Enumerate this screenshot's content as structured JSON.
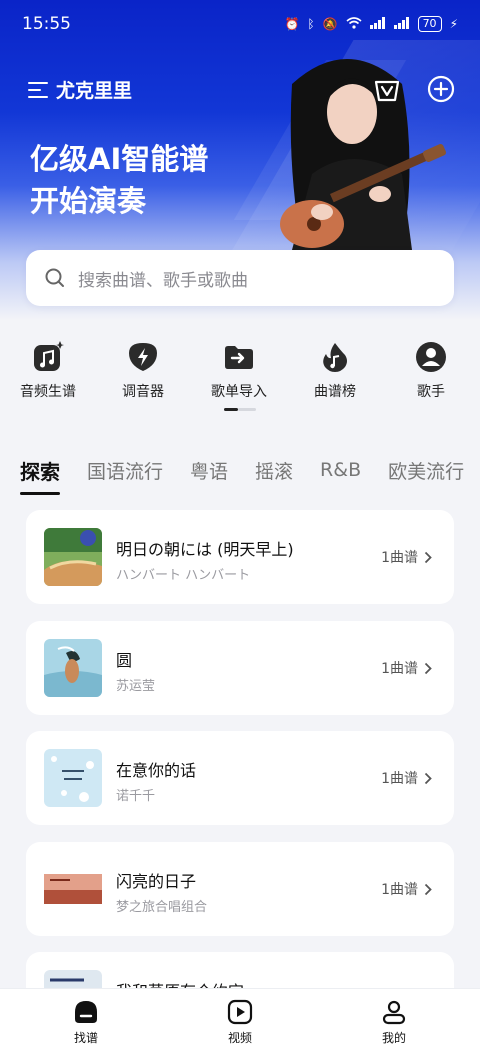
{
  "status_bar": {
    "time": "15:55",
    "battery": "70"
  },
  "header": {
    "brand": "尤克里里",
    "hero_line1": "亿级AI智能谱",
    "hero_line2": "开始演奏"
  },
  "search": {
    "placeholder": "搜索曲谱、歌手或歌曲"
  },
  "quick_actions": [
    {
      "label": "音频生谱",
      "icon": "music-sparkle-icon"
    },
    {
      "label": "调音器",
      "icon": "pick-bolt-icon"
    },
    {
      "label": "歌单导入",
      "icon": "folder-import-icon"
    },
    {
      "label": "曲谱榜",
      "icon": "flame-note-icon"
    },
    {
      "label": "歌手",
      "icon": "person-icon"
    }
  ],
  "tabs": [
    "探索",
    "国语流行",
    "粤语",
    "摇滚",
    "R&B",
    "欧美流行"
  ],
  "songs": [
    {
      "title": "明日の朝には (明天早上)",
      "artist": "ハンバート ハンバート",
      "count": "1曲谱"
    },
    {
      "title": "圆",
      "artist": "苏运莹",
      "count": "1曲谱"
    },
    {
      "title": "在意你的话",
      "artist": "诺千千",
      "count": "1曲谱"
    },
    {
      "title": "闪亮的日子",
      "artist": "梦之旅合唱组合",
      "count": "1曲谱"
    },
    {
      "title": "我和草原有个约定",
      "artist": "",
      "count": ""
    }
  ],
  "bottom_nav": [
    {
      "label": "找谱",
      "icon": "home-icon"
    },
    {
      "label": "视频",
      "icon": "video-icon"
    },
    {
      "label": "我的",
      "icon": "profile-icon"
    }
  ],
  "colors": {
    "hero_blue": "#0a24c8",
    "accent_blue": "#1237d6",
    "background": "#f3f4f8"
  }
}
